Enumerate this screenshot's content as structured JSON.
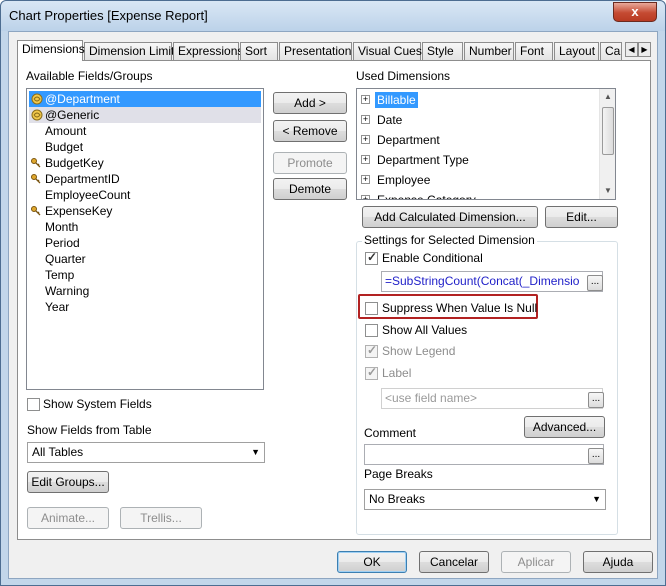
{
  "window": {
    "title": "Chart Properties [Expense Report]",
    "close_glyph": "x"
  },
  "tabs": [
    "Dimensions",
    "Dimension Limits",
    "Expressions",
    "Sort",
    "Presentation",
    "Visual Cues",
    "Style",
    "Number",
    "Font",
    "Layout",
    "Cap"
  ],
  "tab_scroll": {
    "left": "◀",
    "right": "▶"
  },
  "available": {
    "label": "Available Fields/Groups",
    "items": [
      {
        "text": "@Department",
        "icon": "group-icon",
        "selected": true
      },
      {
        "text": "@Generic",
        "icon": "group-icon",
        "selected": false
      },
      {
        "text": "Amount",
        "icon": "",
        "selected": false
      },
      {
        "text": "Budget",
        "icon": "",
        "selected": false
      },
      {
        "text": "BudgetKey",
        "icon": "key-icon",
        "selected": false
      },
      {
        "text": "DepartmentID",
        "icon": "key-icon",
        "selected": false
      },
      {
        "text": "EmployeeCount",
        "icon": "",
        "selected": false
      },
      {
        "text": "ExpenseKey",
        "icon": "key-icon",
        "selected": false
      },
      {
        "text": "Month",
        "icon": "",
        "selected": false
      },
      {
        "text": "Period",
        "icon": "",
        "selected": false
      },
      {
        "text": "Quarter",
        "icon": "",
        "selected": false
      },
      {
        "text": "Temp",
        "icon": "",
        "selected": false
      },
      {
        "text": "Warning",
        "icon": "",
        "selected": false
      },
      {
        "text": "Year",
        "icon": "",
        "selected": false
      }
    ]
  },
  "buttons_mid": {
    "add": "Add >",
    "remove": "< Remove",
    "promote": "Promote",
    "demote": "Demote"
  },
  "used": {
    "label": "Used Dimensions",
    "items": [
      {
        "text": "Billable",
        "selected": true
      },
      {
        "text": "Date",
        "selected": false
      },
      {
        "text": "Department",
        "selected": false
      },
      {
        "text": "Department Type",
        "selected": false
      },
      {
        "text": "Employee",
        "selected": false
      },
      {
        "text": "Expense Category",
        "selected": false
      }
    ],
    "expander_glyph": "+",
    "add_calc": "Add Calculated Dimension...",
    "edit": "Edit..."
  },
  "settings": {
    "title": "Settings for Selected Dimension",
    "enable_conditional": "Enable Conditional",
    "condition_formula": "=SubStringCount(Concat(_Dimensio",
    "suppress_null": "Suppress When Value Is Null",
    "show_all_values": "Show All Values",
    "show_legend": "Show Legend",
    "label": "Label",
    "label_placeholder": "<use field name>",
    "advanced": "Advanced...",
    "comment": "Comment",
    "comment_value": "",
    "page_breaks": "Page Breaks",
    "page_breaks_value": "No Breaks",
    "ellipsis": "..."
  },
  "left_bottom": {
    "show_system_fields": "Show System Fields",
    "show_fields_from_table": "Show Fields from Table",
    "table_value": "All Tables",
    "edit_groups": "Edit Groups...",
    "animate": "Animate...",
    "trellis": "Trellis..."
  },
  "footer": {
    "ok": "OK",
    "cancel": "Cancelar",
    "apply": "Aplicar",
    "help": "Ajuda"
  },
  "glyphs": {
    "dropdown": "▼",
    "scroll_up": "▲",
    "scroll_down": "▼"
  }
}
